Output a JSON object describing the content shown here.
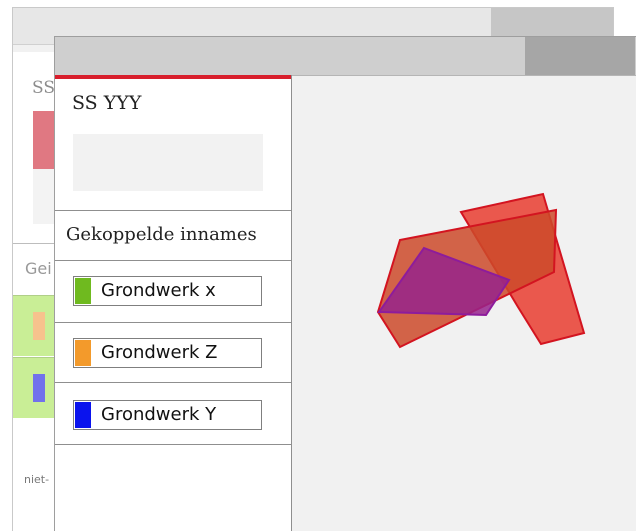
{
  "back_window": {
    "title_partial": "SS",
    "section_partial": "Gei",
    "footer_partial": "niet-"
  },
  "panel": {
    "title": "SS YYY",
    "section_title": "Gekoppelde innames",
    "items": [
      {
        "label": "Grondwerk x",
        "color": "#6fba1f"
      },
      {
        "label": "Grondwerk Z",
        "color": "#f39a2b"
      },
      {
        "label": "Grondwerk Y",
        "color": "#0a13ee"
      }
    ]
  },
  "colors": {
    "accent": "#d81e2c",
    "back_row_green": "#c9ee96",
    "back_swatch_orange": "#f7c28d",
    "back_swatch_blue": "#7171ec"
  }
}
